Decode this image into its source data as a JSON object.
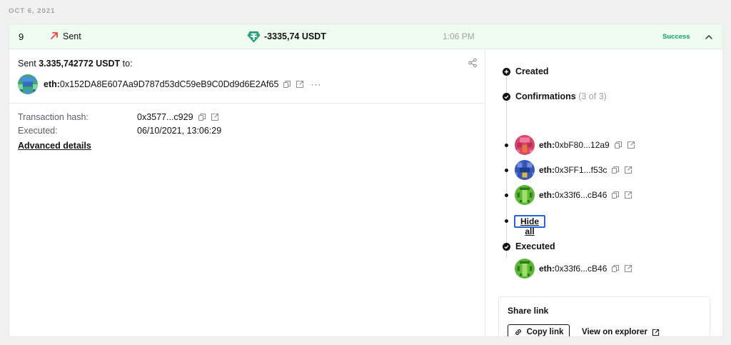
{
  "date_header": "OCT 6, 2021",
  "summary": {
    "nonce": "9",
    "type_label": "Sent",
    "amount": "-3335,74 USDT",
    "time": "1:06 PM",
    "status": "Success",
    "icons": {
      "type": "arrow-up-right-icon",
      "token": "tether-icon",
      "toggle": "chevron-up-icon"
    },
    "colors": {
      "sent_arrow": "#e8473f",
      "token": "#26a17b",
      "status": "#12a85a",
      "header_bg": "#effaf1"
    }
  },
  "details": {
    "sent_prefix": "Sent",
    "sent_amount": "3.335,742772 USDT",
    "sent_suffix": "to:",
    "recipient": {
      "prefix": "eth:",
      "address": "0x152DA8E607Aa9D787d53dC59eB9C0Dd9d6E2Af65"
    },
    "more": "···",
    "info": [
      {
        "label": "Transaction hash:",
        "value": "0x3577...c929"
      },
      {
        "label": "Executed:",
        "value": "06/10/2021, 13:06:29"
      }
    ],
    "advanced_label": "Advanced details"
  },
  "timeline": {
    "created_label": "Created",
    "confirmations_label": "Confirmations",
    "confirmations_count": "(3 of 3)",
    "confirmers": [
      {
        "prefix": "eth:",
        "address": "0xbF80...12a9",
        "avatar_color": "#d9486a"
      },
      {
        "prefix": "eth:",
        "address": "0x3FF1...f53c",
        "avatar_color": "#3558b8"
      },
      {
        "prefix": "eth:",
        "address": "0x33f6...cB46",
        "avatar_color": "#5fb838"
      }
    ],
    "hide_all_label": "Hide all",
    "executed_label": "Executed",
    "executor": {
      "prefix": "eth:",
      "address": "0x33f6...cB46",
      "avatar_color": "#5fb838"
    }
  },
  "share": {
    "title": "Share link",
    "copy_label": "Copy link",
    "explorer_label": "View on explorer"
  }
}
